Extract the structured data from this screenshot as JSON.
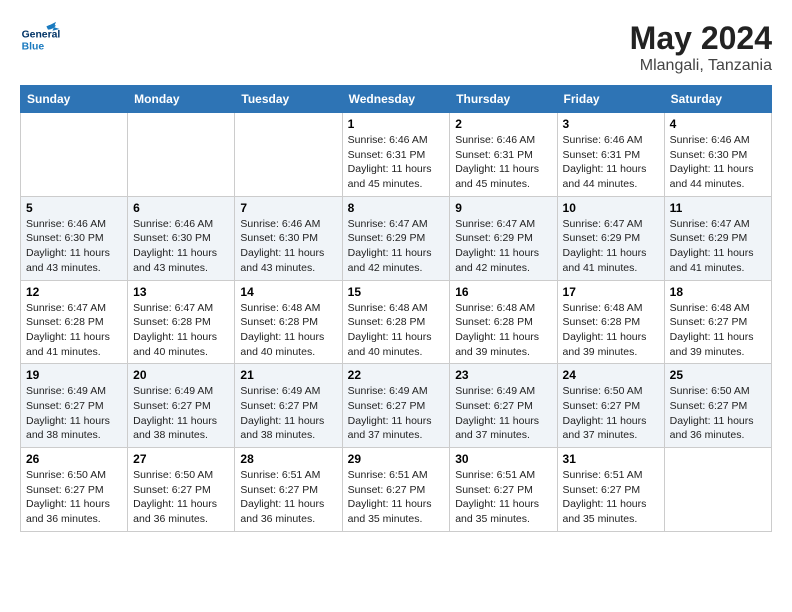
{
  "logo": {
    "line1": "General",
    "line2": "Blue"
  },
  "title": "May 2024",
  "subtitle": "Mlangali, Tanzania",
  "weekdays": [
    "Sunday",
    "Monday",
    "Tuesday",
    "Wednesday",
    "Thursday",
    "Friday",
    "Saturday"
  ],
  "weeks": [
    [
      {
        "day": "",
        "info": ""
      },
      {
        "day": "",
        "info": ""
      },
      {
        "day": "",
        "info": ""
      },
      {
        "day": "1",
        "info": "Sunrise: 6:46 AM\nSunset: 6:31 PM\nDaylight: 11 hours and 45 minutes."
      },
      {
        "day": "2",
        "info": "Sunrise: 6:46 AM\nSunset: 6:31 PM\nDaylight: 11 hours and 45 minutes."
      },
      {
        "day": "3",
        "info": "Sunrise: 6:46 AM\nSunset: 6:31 PM\nDaylight: 11 hours and 44 minutes."
      },
      {
        "day": "4",
        "info": "Sunrise: 6:46 AM\nSunset: 6:30 PM\nDaylight: 11 hours and 44 minutes."
      }
    ],
    [
      {
        "day": "5",
        "info": "Sunrise: 6:46 AM\nSunset: 6:30 PM\nDaylight: 11 hours and 43 minutes."
      },
      {
        "day": "6",
        "info": "Sunrise: 6:46 AM\nSunset: 6:30 PM\nDaylight: 11 hours and 43 minutes."
      },
      {
        "day": "7",
        "info": "Sunrise: 6:46 AM\nSunset: 6:30 PM\nDaylight: 11 hours and 43 minutes."
      },
      {
        "day": "8",
        "info": "Sunrise: 6:47 AM\nSunset: 6:29 PM\nDaylight: 11 hours and 42 minutes."
      },
      {
        "day": "9",
        "info": "Sunrise: 6:47 AM\nSunset: 6:29 PM\nDaylight: 11 hours and 42 minutes."
      },
      {
        "day": "10",
        "info": "Sunrise: 6:47 AM\nSunset: 6:29 PM\nDaylight: 11 hours and 41 minutes."
      },
      {
        "day": "11",
        "info": "Sunrise: 6:47 AM\nSunset: 6:29 PM\nDaylight: 11 hours and 41 minutes."
      }
    ],
    [
      {
        "day": "12",
        "info": "Sunrise: 6:47 AM\nSunset: 6:28 PM\nDaylight: 11 hours and 41 minutes."
      },
      {
        "day": "13",
        "info": "Sunrise: 6:47 AM\nSunset: 6:28 PM\nDaylight: 11 hours and 40 minutes."
      },
      {
        "day": "14",
        "info": "Sunrise: 6:48 AM\nSunset: 6:28 PM\nDaylight: 11 hours and 40 minutes."
      },
      {
        "day": "15",
        "info": "Sunrise: 6:48 AM\nSunset: 6:28 PM\nDaylight: 11 hours and 40 minutes."
      },
      {
        "day": "16",
        "info": "Sunrise: 6:48 AM\nSunset: 6:28 PM\nDaylight: 11 hours and 39 minutes."
      },
      {
        "day": "17",
        "info": "Sunrise: 6:48 AM\nSunset: 6:28 PM\nDaylight: 11 hours and 39 minutes."
      },
      {
        "day": "18",
        "info": "Sunrise: 6:48 AM\nSunset: 6:27 PM\nDaylight: 11 hours and 39 minutes."
      }
    ],
    [
      {
        "day": "19",
        "info": "Sunrise: 6:49 AM\nSunset: 6:27 PM\nDaylight: 11 hours and 38 minutes."
      },
      {
        "day": "20",
        "info": "Sunrise: 6:49 AM\nSunset: 6:27 PM\nDaylight: 11 hours and 38 minutes."
      },
      {
        "day": "21",
        "info": "Sunrise: 6:49 AM\nSunset: 6:27 PM\nDaylight: 11 hours and 38 minutes."
      },
      {
        "day": "22",
        "info": "Sunrise: 6:49 AM\nSunset: 6:27 PM\nDaylight: 11 hours and 37 minutes."
      },
      {
        "day": "23",
        "info": "Sunrise: 6:49 AM\nSunset: 6:27 PM\nDaylight: 11 hours and 37 minutes."
      },
      {
        "day": "24",
        "info": "Sunrise: 6:50 AM\nSunset: 6:27 PM\nDaylight: 11 hours and 37 minutes."
      },
      {
        "day": "25",
        "info": "Sunrise: 6:50 AM\nSunset: 6:27 PM\nDaylight: 11 hours and 36 minutes."
      }
    ],
    [
      {
        "day": "26",
        "info": "Sunrise: 6:50 AM\nSunset: 6:27 PM\nDaylight: 11 hours and 36 minutes."
      },
      {
        "day": "27",
        "info": "Sunrise: 6:50 AM\nSunset: 6:27 PM\nDaylight: 11 hours and 36 minutes."
      },
      {
        "day": "28",
        "info": "Sunrise: 6:51 AM\nSunset: 6:27 PM\nDaylight: 11 hours and 36 minutes."
      },
      {
        "day": "29",
        "info": "Sunrise: 6:51 AM\nSunset: 6:27 PM\nDaylight: 11 hours and 35 minutes."
      },
      {
        "day": "30",
        "info": "Sunrise: 6:51 AM\nSunset: 6:27 PM\nDaylight: 11 hours and 35 minutes."
      },
      {
        "day": "31",
        "info": "Sunrise: 6:51 AM\nSunset: 6:27 PM\nDaylight: 11 hours and 35 minutes."
      },
      {
        "day": "",
        "info": ""
      }
    ]
  ]
}
